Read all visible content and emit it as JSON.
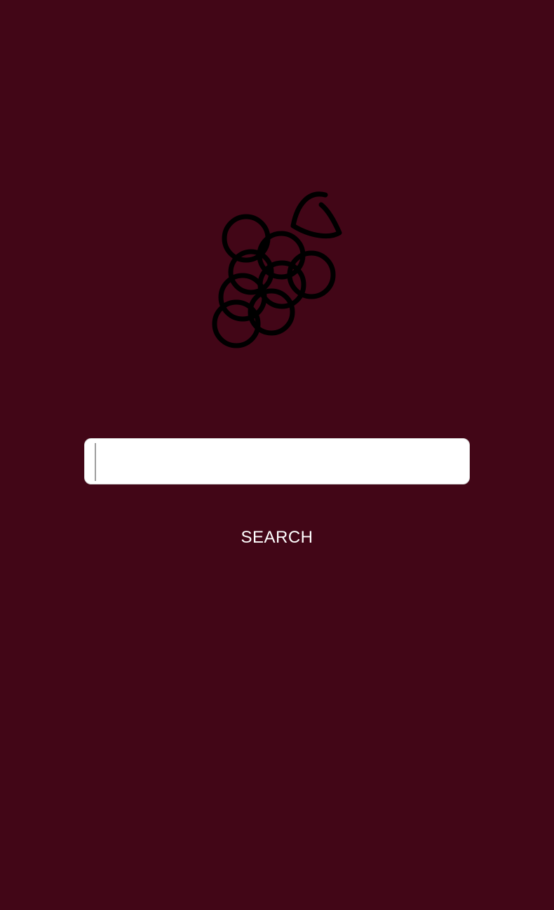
{
  "screen": {
    "background_color": "#420617"
  },
  "logo": {
    "icon": "grapes-icon",
    "stroke_color": "#000000"
  },
  "search": {
    "value": "",
    "placeholder": "",
    "button_label": "SEARCH"
  }
}
